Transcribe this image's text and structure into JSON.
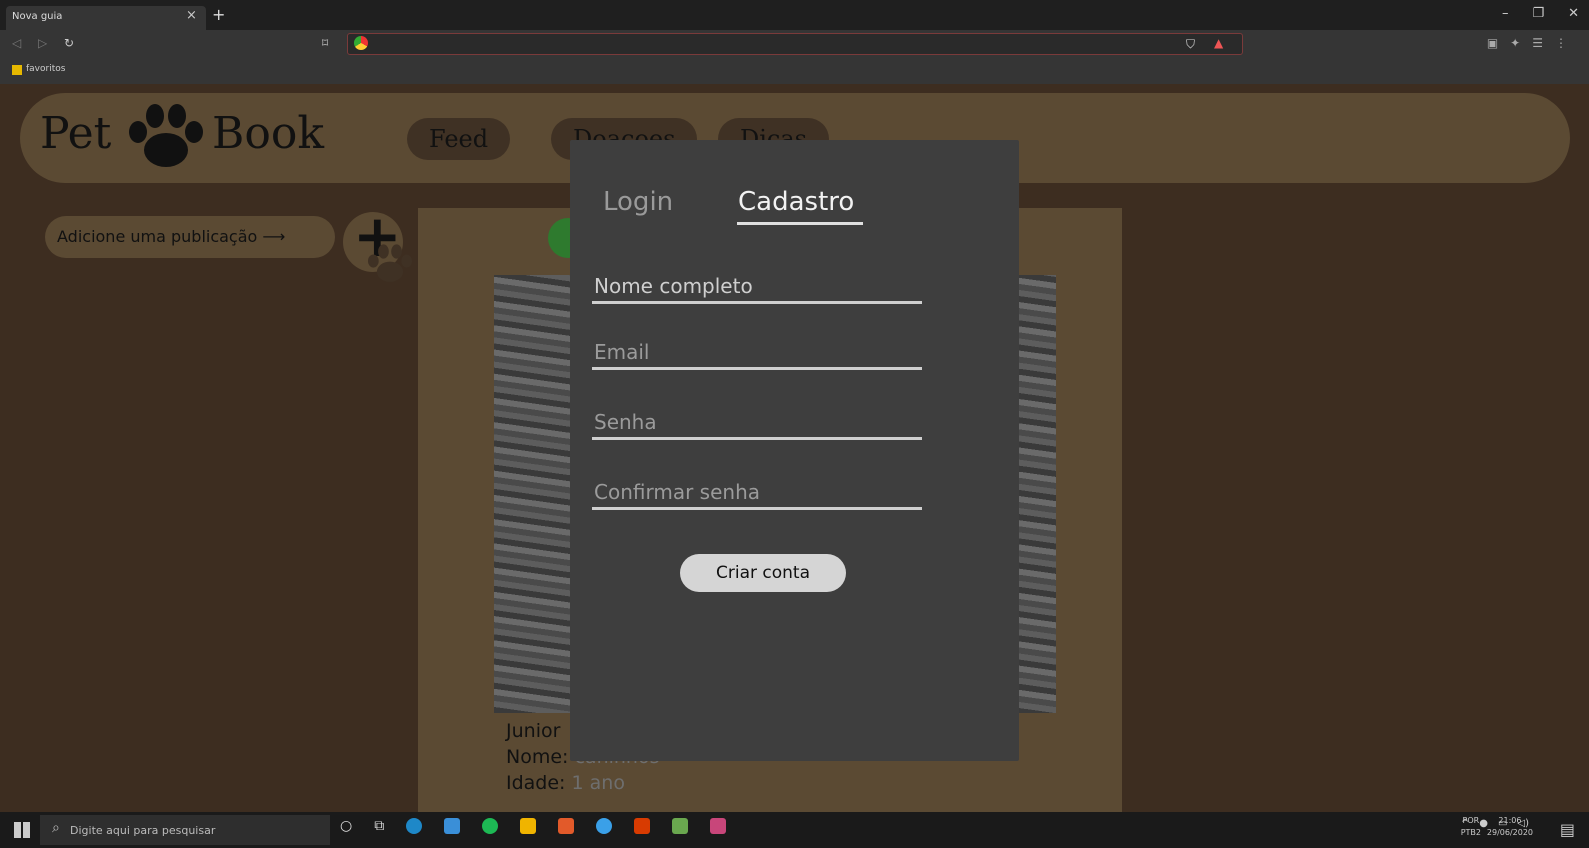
{
  "browser": {
    "tab_title": "Nova guia",
    "tab_close": "×",
    "new_tab": "+",
    "bookmark_folder": "favoritos",
    "window_controls": [
      "–",
      "❐",
      "✕"
    ]
  },
  "app": {
    "logo_left": "Pet",
    "logo_right": "Book",
    "nav": [
      {
        "label": "Feed"
      },
      {
        "label": "Doacoes"
      },
      {
        "label": "Dicas"
      }
    ],
    "add_publication_label": "Adicione uma publicação ⟶",
    "add_button": "+"
  },
  "post": {
    "line1_label": "Junior",
    "line2_label": "Nome:",
    "line2_value": "caninhos",
    "line3_label": "Idade:",
    "line3_value": "1 ano"
  },
  "modal": {
    "tabs": [
      {
        "label": "Login",
        "active": false
      },
      {
        "label": "Cadastro",
        "active": true
      }
    ],
    "fields": [
      {
        "placeholder": "Nome completo",
        "value": ""
      },
      {
        "placeholder": "Email",
        "value": ""
      },
      {
        "placeholder": "Senha",
        "value": ""
      },
      {
        "placeholder": "Confirmar senha",
        "value": ""
      }
    ],
    "submit_label": "Criar conta"
  },
  "taskbar": {
    "search_placeholder": "Digite aqui para pesquisar",
    "lang_line1": "POR",
    "lang_line2": "PTB2",
    "time": "21:06",
    "date": "29/06/2020"
  },
  "colors": {
    "page_bg": "#3d2d20",
    "panel": "#5b4a33",
    "modal_bg": "#3e3e3e",
    "button": "#d5d5d5"
  }
}
